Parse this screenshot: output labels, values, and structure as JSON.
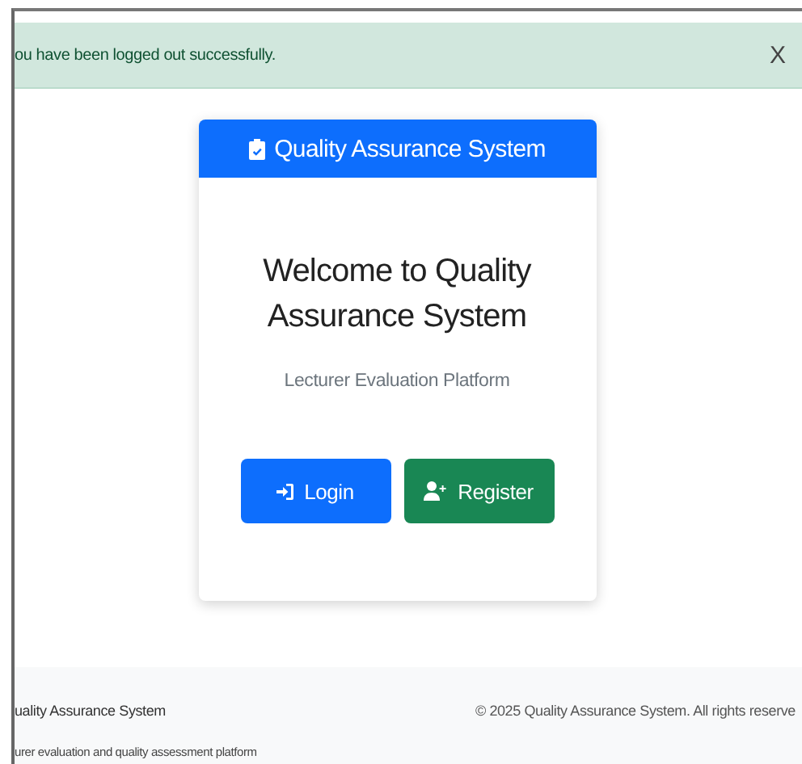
{
  "alert": {
    "message": "ou have been logged out successfully.",
    "close": "X"
  },
  "card": {
    "header": "Quality Assurance System",
    "title": "Welcome to Quality Assurance System",
    "subtitle": "Lecturer Evaluation Platform",
    "buttons": [
      {
        "kind": "login",
        "label": "Login"
      },
      {
        "kind": "register",
        "label": "Register"
      }
    ]
  },
  "footer": {
    "name": "uality Assurance System",
    "tagline": "urer evaluation and quality assessment platform",
    "copyright": "© 2025 Quality Assurance System. All rights reserve"
  }
}
